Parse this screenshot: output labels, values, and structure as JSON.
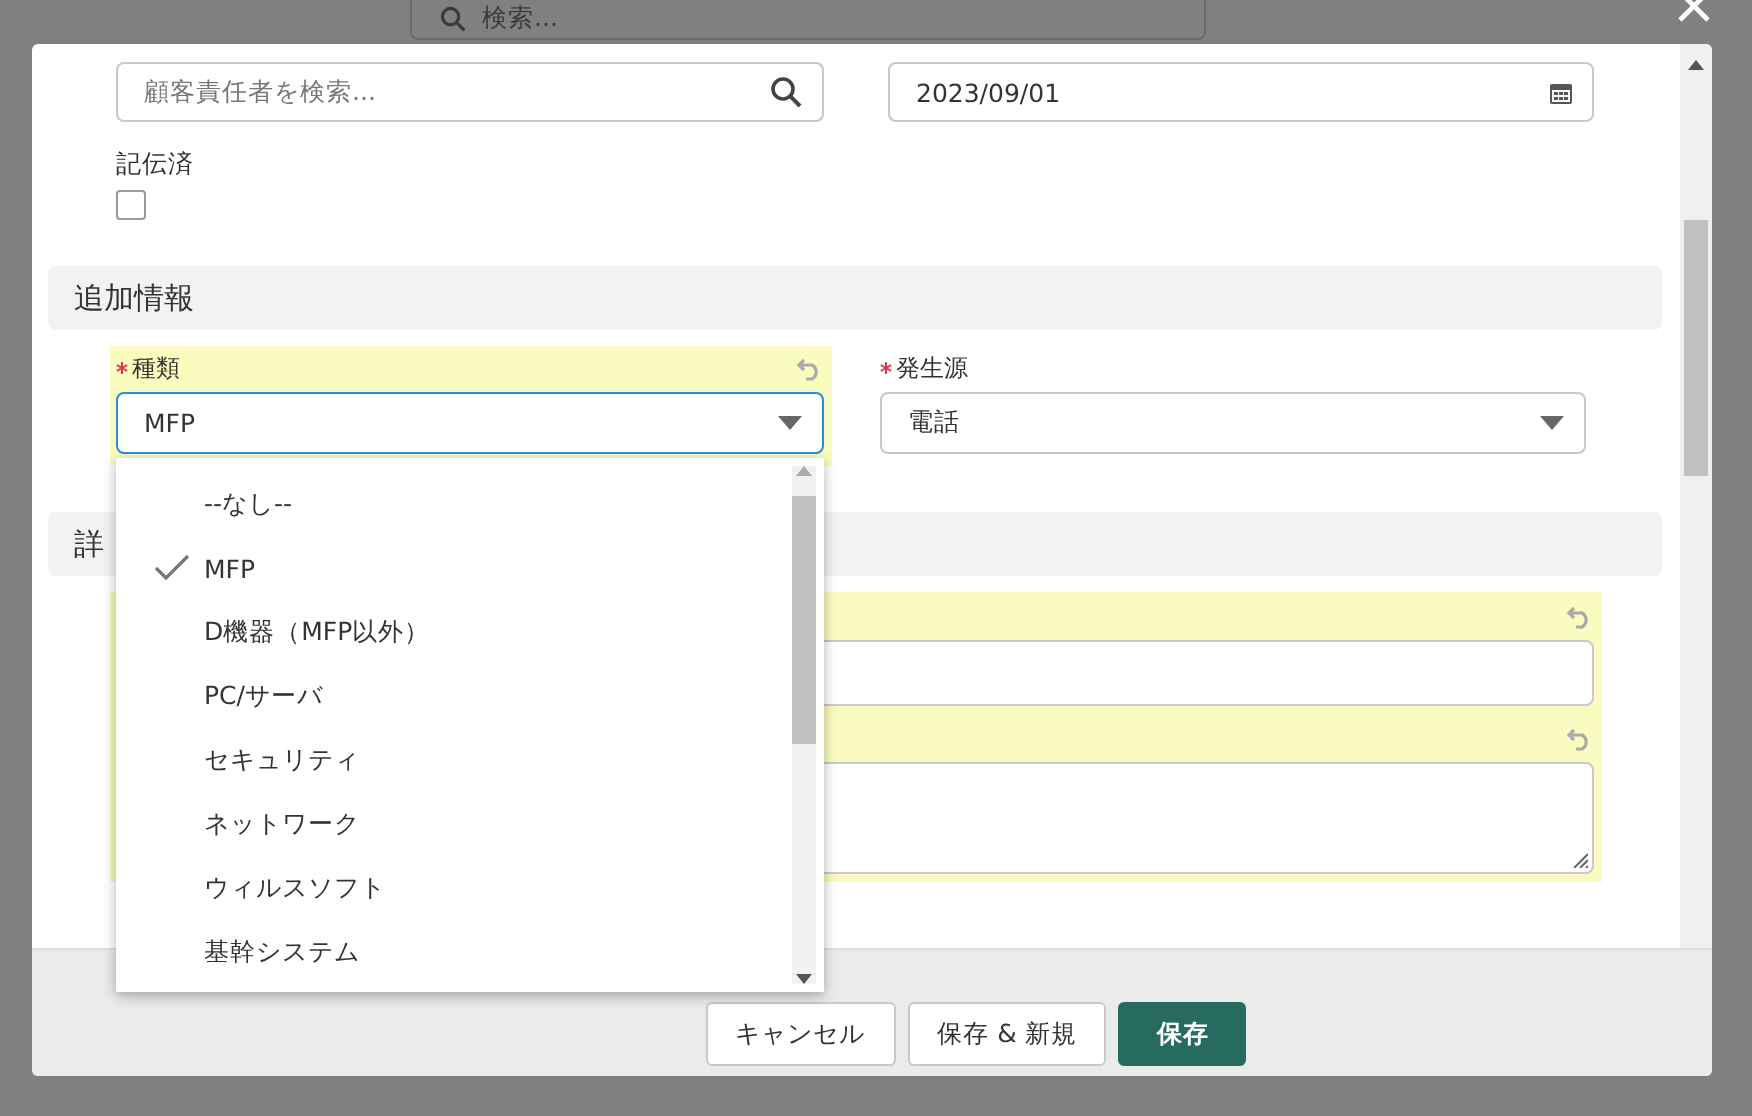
{
  "backdrop": {
    "search": {
      "placeholder": "検索..."
    }
  },
  "top_fields": [
    {
      "kind": "lookup",
      "placeholder": "顧客責任者を検索..."
    },
    {
      "kind": "date",
      "value": "2023/09/01"
    }
  ],
  "checkbox": {
    "label": "記伝済",
    "checked": false
  },
  "sections": [
    {
      "title": "追加情報",
      "fields": [
        {
          "kind": "select",
          "label": "種類",
          "required": true,
          "value": "MFP",
          "changed": true,
          "open": true
        },
        {
          "kind": "select",
          "label": "発生源",
          "required": true,
          "value": "電話",
          "changed": false,
          "open": false
        }
      ]
    },
    {
      "title": "詳",
      "fields": [
        {
          "kind": "input",
          "changed": true
        },
        {
          "kind": "textarea",
          "changed": true
        }
      ]
    }
  ],
  "dropdown": {
    "options": [
      {
        "label": "--なし--",
        "selected": false
      },
      {
        "label": "MFP",
        "selected": true
      },
      {
        "label": "D機器（MFP以外）",
        "selected": false
      },
      {
        "label": "PC/サーバ",
        "selected": false
      },
      {
        "label": "セキュリティ",
        "selected": false
      },
      {
        "label": "ネットワーク",
        "selected": false
      },
      {
        "label": "ウィルスソフト",
        "selected": false
      },
      {
        "label": "基幹システム",
        "selected": false
      }
    ]
  },
  "footer": {
    "buttons": [
      {
        "label": "キャンセル",
        "kind": "secondary"
      },
      {
        "label": "保存 & 新規",
        "kind": "secondary"
      },
      {
        "label": "保存",
        "kind": "primary"
      }
    ]
  }
}
